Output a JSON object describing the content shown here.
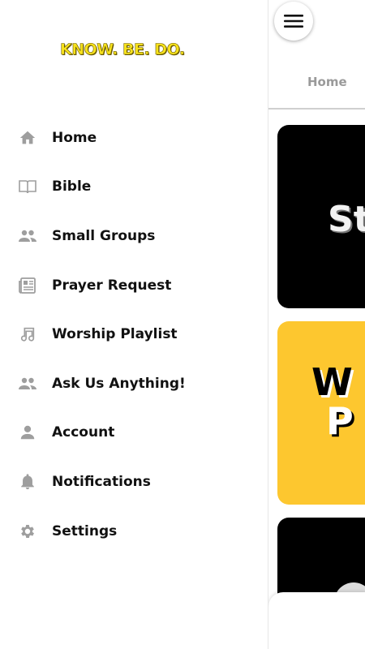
{
  "app": {
    "logo_text": "KNOW. BE. DO."
  },
  "drawer": {
    "items": [
      {
        "label": "Home",
        "icon": "home-icon"
      },
      {
        "label": "Bible",
        "icon": "book-icon"
      },
      {
        "label": "Small Groups",
        "icon": "group-icon"
      },
      {
        "label": "Prayer Request",
        "icon": "newspaper-icon"
      },
      {
        "label": "Worship Playlist",
        "icon": "music-note-icon"
      },
      {
        "label": "Ask Us Anything!",
        "icon": "group-icon"
      },
      {
        "label": "Account",
        "icon": "person-icon"
      },
      {
        "label": "Notifications",
        "icon": "bell-icon"
      },
      {
        "label": "Settings",
        "icon": "gear-icon"
      }
    ]
  },
  "main": {
    "tab_home": "Home",
    "cards": [
      {
        "text": "St"
      },
      {
        "text_line1": "W",
        "text_line2": "P"
      },
      {
        "text": ""
      }
    ]
  },
  "colors": {
    "accent_yellow": "#fdc72f",
    "logo_yellow": "#f7e21c",
    "icon_grey": "#9e9e9e"
  }
}
